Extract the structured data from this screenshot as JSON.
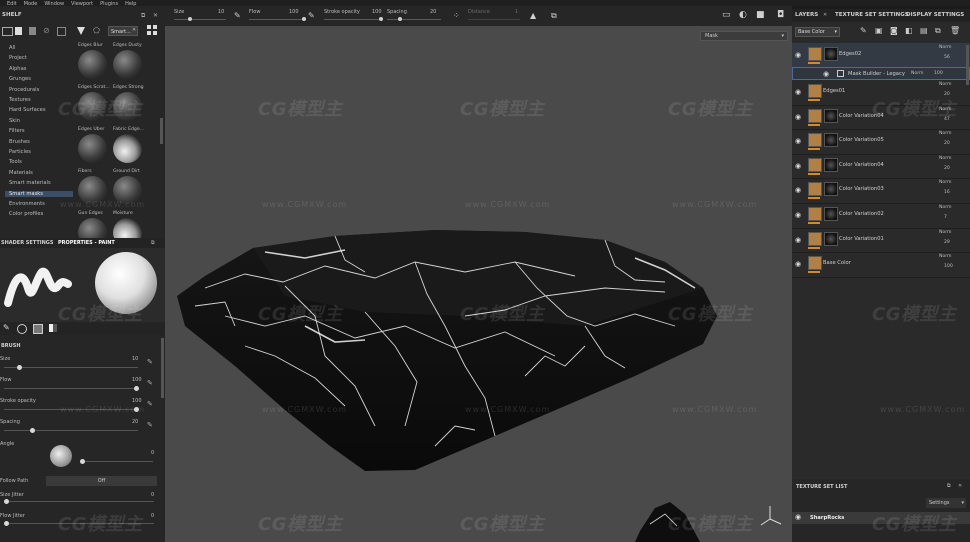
{
  "menu": [
    "Edit",
    "Mode",
    "Window",
    "Viewport",
    "Plugins",
    "Help"
  ],
  "toolbar": {
    "size_label": "Size",
    "size_value": "10",
    "flow_label": "Flow",
    "flow_value": "100",
    "stroke_label": "Stroke opacity",
    "stroke_value": "100",
    "spacing_label": "Spacing",
    "spacing_value": "20",
    "distance_label": "Distance",
    "distance_value": "1"
  },
  "viewport": {
    "mode_select": "Mask"
  },
  "watermark": {
    "logo": "CG模型主",
    "url": "www.CGMXW.com"
  },
  "shelf": {
    "title": "SHELF",
    "search_value": "Smart...",
    "categories": [
      "All",
      "Project",
      "Alphas",
      "Grunges",
      "Procedurals",
      "Textures",
      "Hard Surfaces",
      "Skin",
      "Filters",
      "Brushes",
      "Particles",
      "Tools",
      "Materials",
      "Smart materials",
      "Smart masks",
      "Environments",
      "Color profiles"
    ],
    "selected_category": "Smart masks",
    "thumbnails": [
      {
        "label": "Edges Blur",
        "style": "dark"
      },
      {
        "label": "Edges Dusty",
        "style": "dark"
      },
      {
        "label": "Edges Scrat...",
        "style": "dark"
      },
      {
        "label": "Edges Strong",
        "style": "dark"
      },
      {
        "label": "Edges Uber",
        "style": "dark"
      },
      {
        "label": "Fabric Edge...",
        "style": "light"
      },
      {
        "label": "Fibers",
        "style": "dark"
      },
      {
        "label": "Ground Dirt",
        "style": "dark"
      },
      {
        "label": "Gun Edges",
        "style": "dark"
      },
      {
        "label": "Moisture",
        "style": "light"
      }
    ]
  },
  "properties": {
    "tab1": "SHADER SETTINGS",
    "tab2": "PROPERTIES - PAINT",
    "section": "BRUSH",
    "params": [
      {
        "label": "Size",
        "value": "10",
        "level": 0.1
      },
      {
        "label": "Flow",
        "value": "100",
        "level": 1.0
      },
      {
        "label": "Stroke opacity",
        "value": "100",
        "level": 1.0
      },
      {
        "label": "Spacing",
        "value": "20",
        "level": 0.2
      }
    ],
    "angle_label": "Angle",
    "angle_value": "0",
    "follow_path_label": "Follow Path",
    "follow_path_value": "Off",
    "size_jitter_label": "Size Jitter",
    "size_jitter_value": "0",
    "flow_jitter_label": "Flow Jitter",
    "flow_jitter_value": "0"
  },
  "layers_panel": {
    "tabs": [
      "LAYERS",
      "TEXTURE SET SETTINGS",
      "DISPLAY SETTINGS"
    ],
    "channel_select": "Base Color",
    "layers": [
      {
        "name": "Edges02",
        "blend": "Norm",
        "opacity": "56",
        "mask": true,
        "selected": true
      },
      {
        "name": "Mask Builder - Legacy",
        "blend": "Norm",
        "opacity": "100",
        "sub": true
      },
      {
        "name": "Edges01",
        "blend": "Norm",
        "opacity": "20",
        "mask": false
      },
      {
        "name": "Color Variation04",
        "blend": "Norm",
        "opacity": "47",
        "mask": true
      },
      {
        "name": "Color Variation05",
        "blend": "Norm",
        "opacity": "20",
        "mask": true
      },
      {
        "name": "Color Variation04",
        "blend": "Norm",
        "opacity": "20",
        "mask": true
      },
      {
        "name": "Color Variation03",
        "blend": "Norm",
        "opacity": "16",
        "mask": true
      },
      {
        "name": "Color Variation02",
        "blend": "Norm",
        "opacity": "7",
        "mask": true
      },
      {
        "name": "Color Variation01",
        "blend": "Norm",
        "opacity": "29",
        "mask": true
      },
      {
        "name": "Base Color",
        "blend": "Norm",
        "opacity": "100",
        "mask": false
      }
    ]
  },
  "texture_set_list": {
    "title": "TEXTURE SET LIST",
    "settings_label": "Settings",
    "item": "SharpRocks"
  },
  "colors": {
    "accent": "#3a4e66",
    "orange": "#d28a2c",
    "viewport": "#4a4a4a"
  }
}
